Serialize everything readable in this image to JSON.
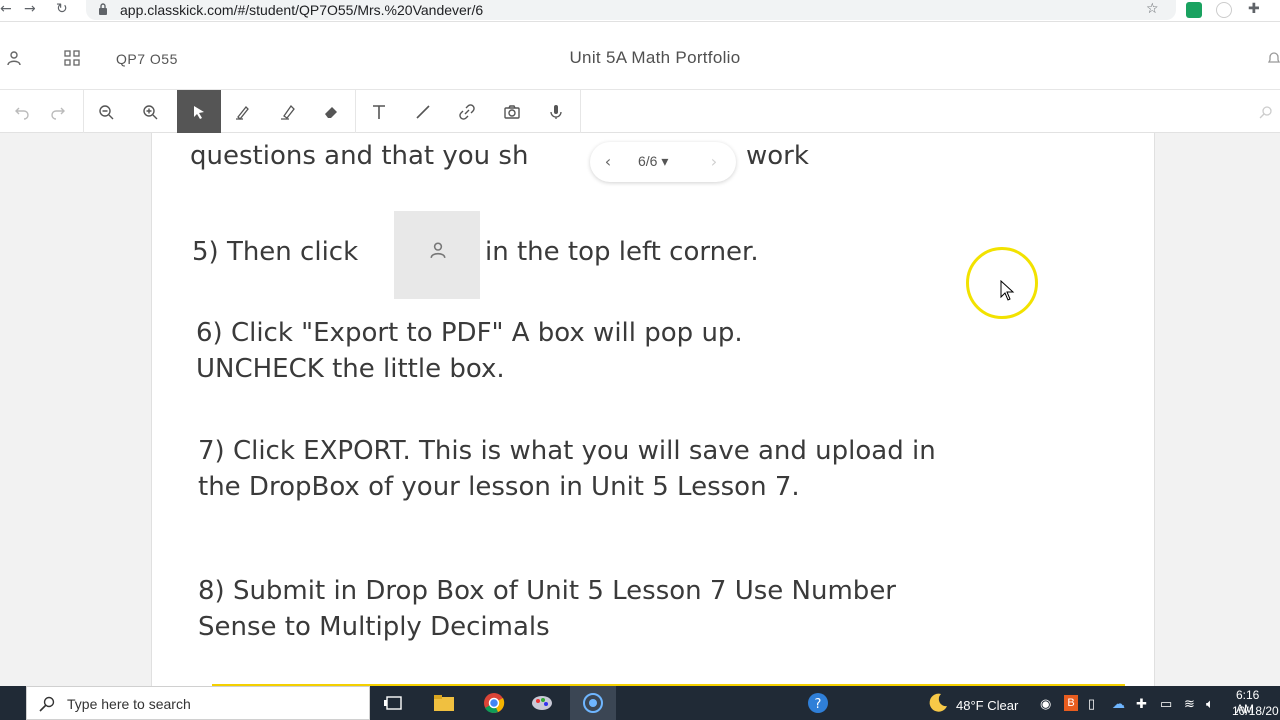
{
  "browser": {
    "url": "app.classkick.com/#/student/QP7O55/Mrs.%20Vandever/6"
  },
  "header": {
    "class_code": "QP7 O55",
    "title": "Unit 5A Math Portfolio"
  },
  "pager": {
    "prev": "‹",
    "count": "6/6 ▾",
    "next": "›"
  },
  "content": {
    "step4_partial": "questions and that you sh",
    "step4_end": "work",
    "step5_a": "5) Then click",
    "step5_b": "in the top left corner.",
    "step6_line1": "6) Click \"Export to PDF\" A box will pop up.",
    "step6_line2": "UNCHECK the little box.",
    "step7_line1": "7) Click EXPORT. This is what you will save and upload in",
    "step7_line2": "the DropBox of your lesson in Unit 5 Lesson 7.",
    "step8_line1": "8) Submit in Drop Box of Unit 5 Lesson 7 Use Number",
    "step8_line2": "Sense to Multiply Decimals"
  },
  "taskbar": {
    "search_placeholder": "Type here to search",
    "weather": "48°F  Clear",
    "time": "6:16 AM",
    "date": "10/18/20"
  },
  "colors": {
    "accent_active_tool": "#555555",
    "cursor_highlight": "#f2e200",
    "taskbar": "#202a36"
  }
}
